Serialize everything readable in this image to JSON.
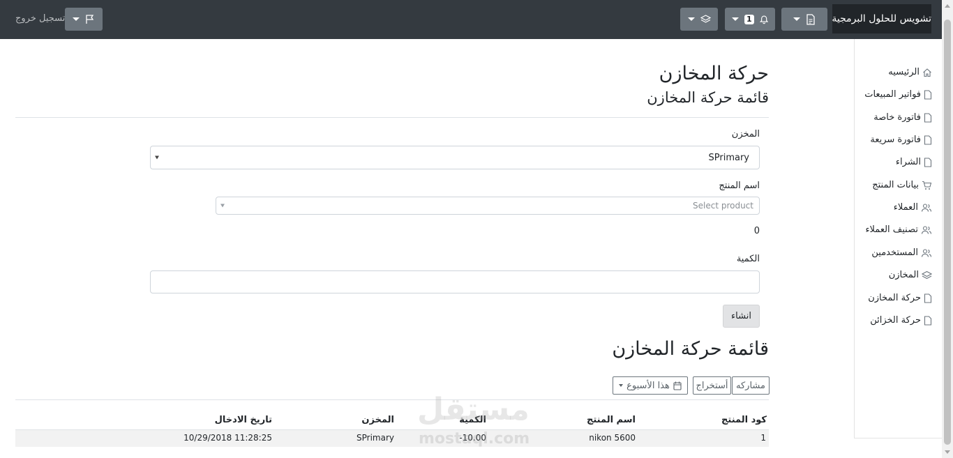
{
  "navbar": {
    "brand": "تشويس للحلول البرمجية",
    "notification_count": "1",
    "logout_label": "تسجيل خروج"
  },
  "sidebar": {
    "items": [
      {
        "label": "الرئيسيه",
        "icon": "home-icon"
      },
      {
        "label": "فواتير المبيعات",
        "icon": "file-icon"
      },
      {
        "label": "فاتورة خاصة",
        "icon": "file-icon"
      },
      {
        "label": "فاتورة سريعة",
        "icon": "file-icon"
      },
      {
        "label": "الشراء",
        "icon": "file-icon"
      },
      {
        "label": "بيانات المنتج",
        "icon": "cart-icon"
      },
      {
        "label": "العملاء",
        "icon": "users-icon"
      },
      {
        "label": "تصنيف العملاء",
        "icon": "users-icon"
      },
      {
        "label": "المستخدمين",
        "icon": "users-icon"
      },
      {
        "label": "المخازن",
        "icon": "layers-icon"
      },
      {
        "label": "حركة المخازن",
        "icon": "file-icon"
      },
      {
        "label": "حركة الخزائن",
        "icon": "file-icon"
      }
    ]
  },
  "page": {
    "title": "حركة المخازن",
    "subtitle": "قائمة حركة المخازن"
  },
  "form": {
    "store_label": "المخزن",
    "store_value": "SPrimary",
    "product_label": "اسم المنتج",
    "product_placeholder": "Select product",
    "available_qty": "0",
    "quantity_label": "الكمية",
    "create_label": "انشاء"
  },
  "list": {
    "title": "قائمة حركة المخازن",
    "share_label": "مشاركه",
    "export_label": "أستخراج",
    "date_filter_label": "هذا الأسبوع"
  },
  "table": {
    "headers": [
      "كود المنتج",
      "اسم المنتج",
      "الكمية",
      "المخزن",
      "تاريخ الادخال"
    ],
    "rows": [
      [
        "1",
        "nikon 5600",
        "-10.00",
        "SPrimary",
        "10/29/2018 11:28:25"
      ]
    ]
  },
  "watermark": {
    "text": "مستقل",
    "sub": "mostaql.com"
  }
}
